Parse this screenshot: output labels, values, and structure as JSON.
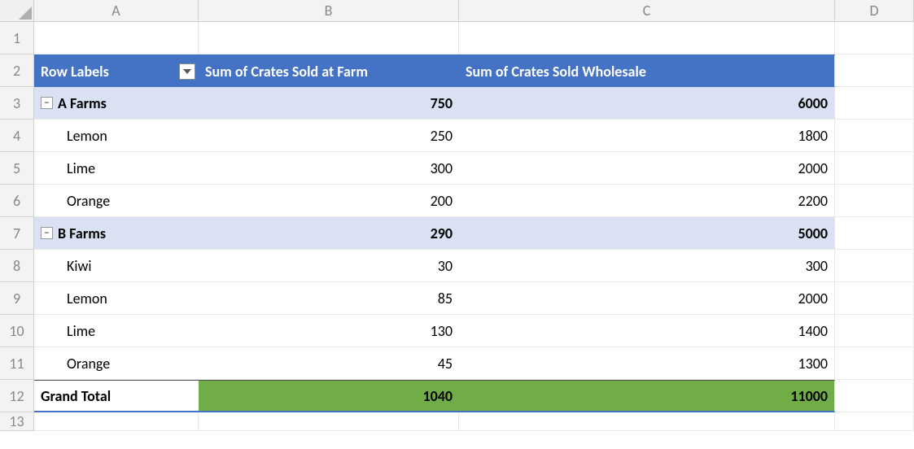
{
  "columns": [
    "A",
    "B",
    "C",
    "D"
  ],
  "row_count": 13,
  "pivot": {
    "header": {
      "row_labels": "Row Labels",
      "col_b": "Sum of Crates Sold at Farm",
      "col_c": "Sum of Crates Sold Wholesale"
    },
    "groups": [
      {
        "name": "A Farms",
        "sum_b": "750",
        "sum_c": "6000",
        "items": [
          {
            "name": "Lemon",
            "b": "250",
            "c": "1800"
          },
          {
            "name": "Lime",
            "b": "300",
            "c": "2000"
          },
          {
            "name": "Orange",
            "b": "200",
            "c": "2200"
          }
        ]
      },
      {
        "name": "B Farms",
        "sum_b": "290",
        "sum_c": "5000",
        "items": [
          {
            "name": "Kiwi",
            "b": "30",
            "c": "300"
          },
          {
            "name": "Lemon",
            "b": "85",
            "c": "2000"
          },
          {
            "name": "Lime",
            "b": "130",
            "c": "1400"
          },
          {
            "name": "Orange",
            "b": "45",
            "c": "1300"
          }
        ]
      }
    ],
    "grand_total": {
      "label": "Grand Total",
      "b": "1040",
      "c": "11000"
    },
    "collapse_glyph": "−"
  }
}
